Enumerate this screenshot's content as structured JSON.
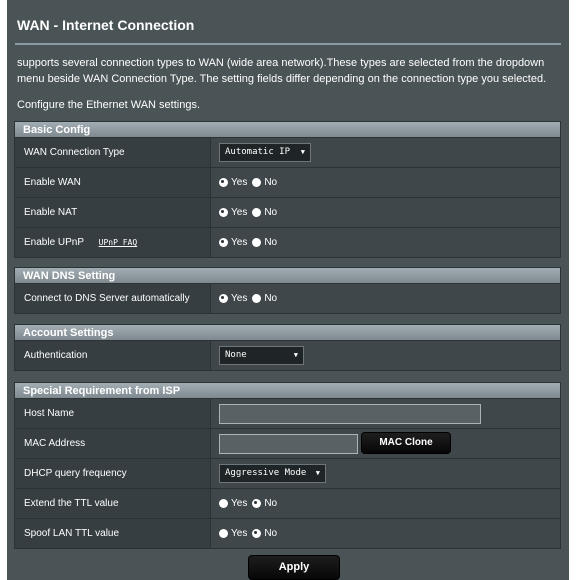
{
  "page": {
    "title": "WAN - Internet Connection",
    "description": "supports several connection types to WAN (wide area network).These types are selected from the dropdown menu beside WAN Connection Type. The setting fields differ depending on the connection type you selected.",
    "configure_text": "Configure the Ethernet WAN settings."
  },
  "basic": {
    "header": "Basic Config",
    "wan_type_label": "WAN Connection Type",
    "wan_type_value": "Automatic IP",
    "enable_wan_label": "Enable WAN",
    "enable_nat_label": "Enable NAT",
    "enable_upnp_label": "Enable UPnP",
    "upnp_faq": "UPnP_FAQ"
  },
  "dns": {
    "header": "WAN DNS Setting",
    "connect_label": "Connect to DNS Server automatically"
  },
  "account": {
    "header": "Account Settings",
    "auth_label": "Authentication",
    "auth_value": "None"
  },
  "isp": {
    "header": "Special Requirement from ISP",
    "host_label": "Host Name",
    "host_value": "",
    "mac_label": "MAC Address",
    "mac_value": "",
    "mac_clone": "MAC Clone",
    "dhcp_label": "DHCP query frequency",
    "dhcp_value": "Aggressive Mode",
    "ttl_label": "Extend the TTL value",
    "spoof_label": "Spoof LAN TTL value"
  },
  "radio": {
    "yes": "Yes",
    "no": "No"
  },
  "apply": "Apply",
  "icons": {
    "dropdown": "chevron-down-icon"
  },
  "colors": {
    "panel": "#4a5356",
    "section_header": "#8f9aa0",
    "button": "#0f0f0f"
  }
}
